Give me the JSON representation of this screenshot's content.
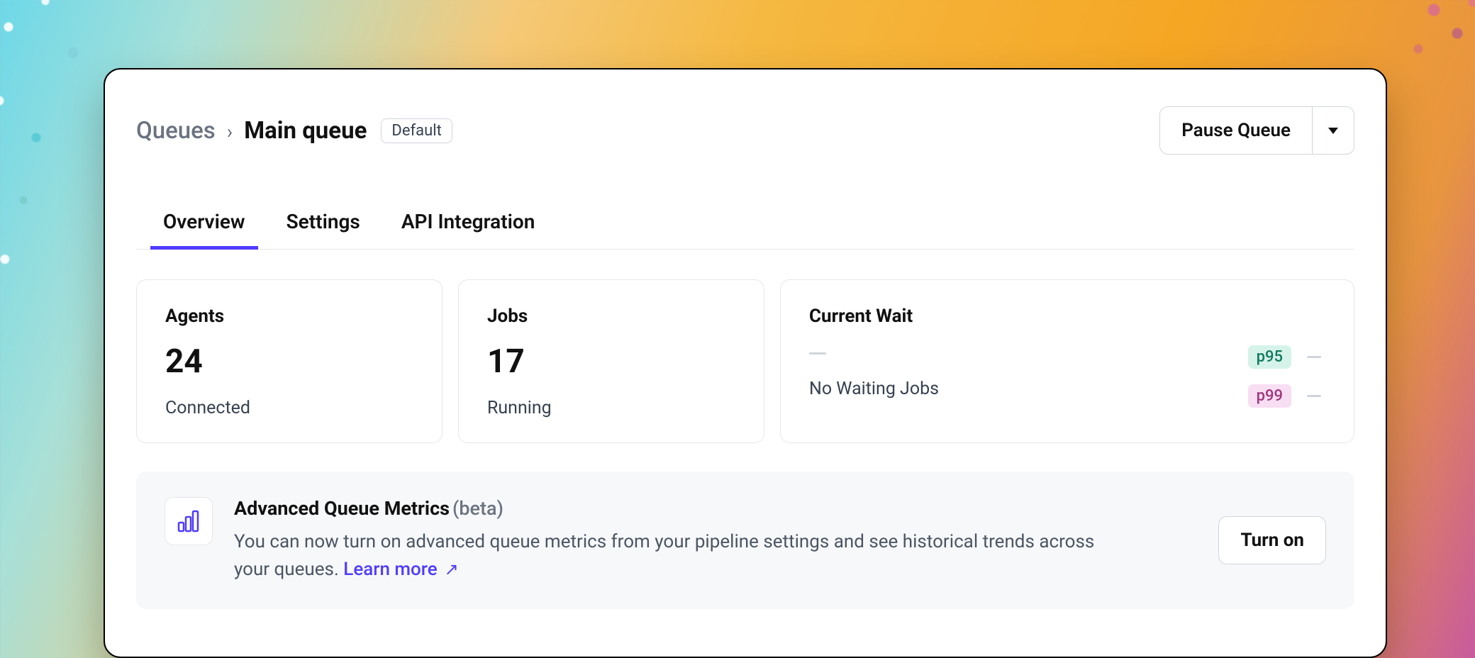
{
  "breadcrumb": {
    "root": "Queues",
    "current": "Main queue",
    "badge": "Default"
  },
  "actions": {
    "pause_label": "Pause Queue"
  },
  "tabs": [
    {
      "label": "Overview",
      "active": true
    },
    {
      "label": "Settings",
      "active": false
    },
    {
      "label": "API Integration",
      "active": false
    }
  ],
  "stats": {
    "agents": {
      "title": "Agents",
      "value": "24",
      "sub": "Connected"
    },
    "jobs": {
      "title": "Jobs",
      "value": "17",
      "sub": "Running"
    },
    "wait": {
      "title": "Current Wait",
      "value": "—",
      "sub": "No Waiting Jobs",
      "percentiles": {
        "p95": {
          "label": "p95",
          "value": "—"
        },
        "p99": {
          "label": "p99",
          "value": "—"
        }
      }
    }
  },
  "promo": {
    "title": "Advanced Queue Metrics",
    "beta": "(beta)",
    "desc": "You can now turn on advanced queue metrics from your pipeline settings and see historical trends across your queues. ",
    "learn_more": "Learn more",
    "button": "Turn on",
    "icon": "bar-chart-icon"
  },
  "colors": {
    "accent": "#4f3cff",
    "p95_bg": "#d6f3ea",
    "p99_bg": "#f8def2"
  }
}
